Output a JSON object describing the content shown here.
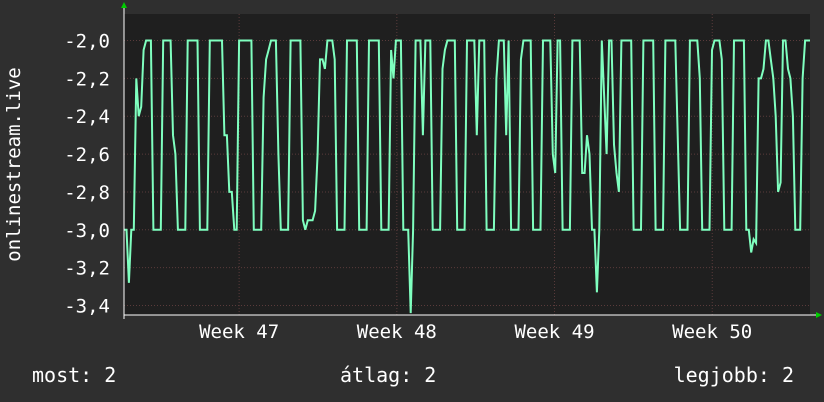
{
  "chart_data": {
    "type": "line",
    "ylabel": "onlinestream.live",
    "ylim": [
      -3.45,
      -1.86
    ],
    "yticks": [
      -2.0,
      -2.2,
      -2.4,
      -2.6,
      -2.8,
      -3.0,
      -3.2,
      -3.4
    ],
    "ytick_labels": [
      "-2,0",
      "-2,2",
      "-2,4",
      "-2,6",
      "-2,8",
      "-3,0",
      "-3,2",
      "-3,4"
    ],
    "xlim": [
      0,
      4.35
    ],
    "xticks": [
      0.73,
      1.73,
      2.73,
      3.73
    ],
    "xtick_labels": [
      "Week 47",
      "Week 48",
      "Week 49",
      "Week 50"
    ],
    "grid": true,
    "colors": {
      "background": "#2f2f2f",
      "plot": "#1f1f1f",
      "line": "#7fffbf",
      "grid": "#5a3b3b",
      "axis_arrow": "#00cc00"
    },
    "series": [
      {
        "values": [
          -3.0,
          -3.0,
          -3.28,
          -3.0,
          -3.0,
          -2.2,
          -2.4,
          -2.35,
          -2.05,
          -2.0,
          -2.0,
          -2.0,
          -3.0,
          -3.0,
          -3.0,
          -3.0,
          -2.0,
          -2.0,
          -2.0,
          -2.0,
          -2.5,
          -2.6,
          -3.0,
          -3.0,
          -3.0,
          -3.0,
          -2.0,
          -2.0,
          -2.0,
          -2.0,
          -2.0,
          -3.0,
          -3.0,
          -3.0,
          -3.0,
          -2.0,
          -2.0,
          -2.0,
          -2.0,
          -2.0,
          -2.0,
          -2.5,
          -2.5,
          -2.8,
          -2.8,
          -3.0,
          -3.0,
          -2.0,
          -2.0,
          -2.0,
          -2.0,
          -2.0,
          -2.0,
          -3.0,
          -3.0,
          -3.0,
          -3.0,
          -2.3,
          -2.1,
          -2.05,
          -2.0,
          -2.0,
          -2.0,
          -2.6,
          -3.0,
          -3.0,
          -3.0,
          -3.0,
          -2.0,
          -2.0,
          -2.0,
          -2.0,
          -2.0,
          -2.95,
          -3.0,
          -2.95,
          -2.95,
          -2.95,
          -2.9,
          -2.6,
          -2.1,
          -2.1,
          -2.15,
          -2.0,
          -2.0,
          -2.0,
          -2.1,
          -3.0,
          -3.0,
          -3.0,
          -3.0,
          -2.0,
          -2.0,
          -2.0,
          -2.0,
          -2.0,
          -3.0,
          -3.0,
          -3.0,
          -3.0,
          -2.0,
          -2.0,
          -2.0,
          -2.0,
          -2.0,
          -3.0,
          -3.0,
          -3.0,
          -3.0,
          -2.05,
          -2.2,
          -2.0,
          -2.0,
          -2.0,
          -3.0,
          -3.0,
          -3.0,
          -3.44,
          -3.0,
          -2.0,
          -2.0,
          -2.0,
          -2.5,
          -2.0,
          -2.0,
          -2.0,
          -3.0,
          -3.0,
          -3.0,
          -3.0,
          -2.15,
          -2.05,
          -2.0,
          -2.0,
          -2.0,
          -2.0,
          -3.0,
          -3.0,
          -3.0,
          -3.0,
          -2.0,
          -2.0,
          -2.0,
          -2.0,
          -2.5,
          -2.0,
          -2.0,
          -2.0,
          -3.0,
          -3.0,
          -3.0,
          -3.0,
          -2.2,
          -2.0,
          -2.0,
          -2.0,
          -2.5,
          -2.0,
          -3.0,
          -3.0,
          -3.0,
          -3.0,
          -2.1,
          -2.0,
          -2.0,
          -2.0,
          -2.0,
          -3.0,
          -3.0,
          -3.0,
          -3.0,
          -2.0,
          -2.0,
          -2.0,
          -2.0,
          -2.6,
          -2.7,
          -2.0,
          -2.0,
          -3.0,
          -3.0,
          -3.0,
          -3.0,
          -2.0,
          -2.0,
          -2.0,
          -2.0,
          -2.7,
          -2.7,
          -2.5,
          -2.6,
          -3.0,
          -3.0,
          -3.33,
          -3.0,
          -2.0,
          -2.3,
          -2.6,
          -2.0,
          -2.0,
          -2.55,
          -2.7,
          -2.8,
          -2.0,
          -2.0,
          -2.0,
          -2.0,
          -2.0,
          -3.0,
          -3.0,
          -3.0,
          -3.0,
          -2.0,
          -2.0,
          -2.0,
          -2.0,
          -2.0,
          -3.0,
          -3.0,
          -3.0,
          -3.0,
          -2.0,
          -2.0,
          -2.0,
          -2.0,
          -2.0,
          -2.5,
          -3.0,
          -3.0,
          -3.0,
          -3.0,
          -2.0,
          -2.0,
          -2.0,
          -2.0,
          -2.2,
          -3.0,
          -3.0,
          -3.0,
          -3.0,
          -2.05,
          -2.0,
          -2.0,
          -2.0,
          -2.1,
          -3.0,
          -3.0,
          -3.0,
          -3.0,
          -2.0,
          -2.0,
          -2.0,
          -2.0,
          -2.0,
          -3.0,
          -3.0,
          -3.12,
          -3.05,
          -3.07,
          -2.2,
          -2.2,
          -2.15,
          -2.0,
          -2.0,
          -2.1,
          -2.2,
          -2.4,
          -2.8,
          -2.75,
          -2.0,
          -2.0,
          -2.15,
          -2.2,
          -2.4,
          -3.0,
          -3.0,
          -3.0,
          -2.2,
          -2.0,
          -2.0,
          -2.0
        ]
      }
    ]
  },
  "legend": {
    "current": "most: 2",
    "average": "átlag: 2",
    "max": "legjobb: 2"
  }
}
